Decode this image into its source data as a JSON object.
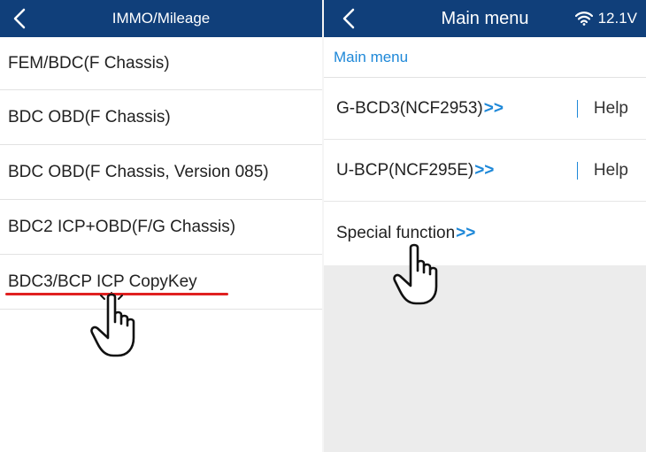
{
  "left_panel": {
    "title": "IMMO/Mileage",
    "items": [
      {
        "label": "FEM/BDC(F Chassis)"
      },
      {
        "label": "BDC OBD(F Chassis)"
      },
      {
        "label": "BDC OBD(F Chassis, Version 085)"
      },
      {
        "label": "BDC2 ICP+OBD(F/G Chassis)"
      },
      {
        "label": "BDC3/BCP ICP CopyKey"
      }
    ],
    "highlight_color": "#e02020"
  },
  "right_panel": {
    "title": "Main menu",
    "battery_voltage": "12.1V",
    "status_icon": "wifi-icon",
    "breadcrumb": "Main menu",
    "items": [
      {
        "label": "G-BCD3(NCF2953)",
        "suffix": ">>",
        "help": "Help"
      },
      {
        "label": "U-BCP(NCF295E)",
        "suffix": ">>",
        "help": "Help"
      },
      {
        "label": "Special function",
        "suffix": ">>"
      }
    ]
  },
  "colors": {
    "header_bg": "#103f7a",
    "accent_blue": "#1e88d8"
  },
  "icons": [
    "back-arrow-icon",
    "wifi-icon",
    "pointing-hand-icon"
  ]
}
